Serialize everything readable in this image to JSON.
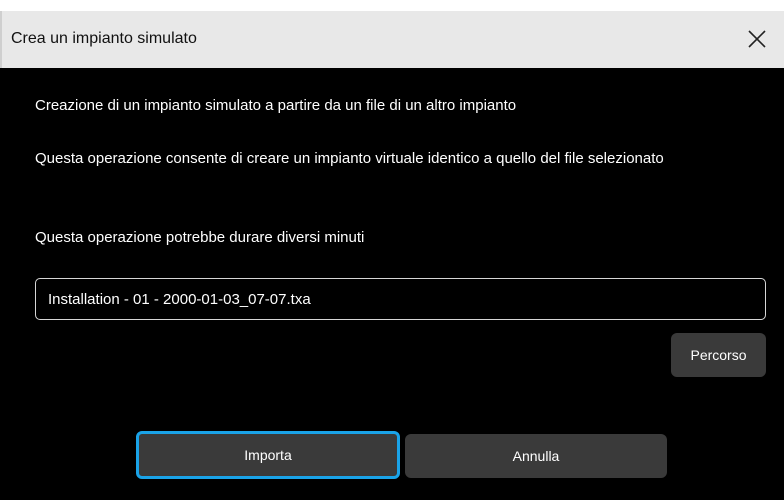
{
  "dialog": {
    "title": "Crea un impianto simulato",
    "close_icon": "close-icon",
    "lines": [
      "Creazione di un impianto simulato a partire da un file di un altro impianto",
      "Questa operazione consente di creare un impianto virtuale identico a quello del file selezionato",
      "Questa operazione potrebbe durare diversi minuti"
    ],
    "file_input": {
      "value": "Installation - 01 - 2000-01-03_07-07.txa"
    },
    "buttons": {
      "path_label": "Percorso",
      "import_label": "Importa",
      "cancel_label": "Annulla"
    },
    "colors": {
      "title_bar": "#e8e8e8",
      "body_bg": "#000000",
      "button_bg": "#3a3a3a",
      "focus_border": "#1aa3e8"
    }
  }
}
